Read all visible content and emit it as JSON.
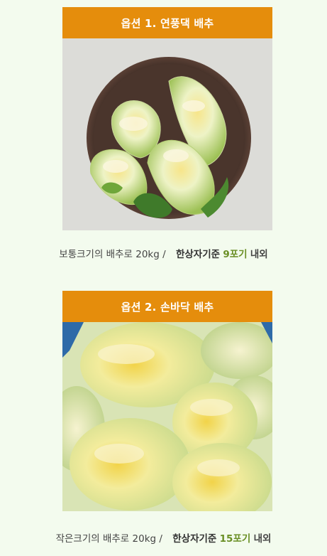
{
  "options": [
    {
      "title": "옵션 1. 연풍댁 배추",
      "image_alt": "napa-cabbage-in-bowl",
      "caption_desc": "보통크기의 배추로 20kg /",
      "caption_std": "한상자기준",
      "caption_count": "9포기",
      "caption_suffix": "내외"
    },
    {
      "title": "옵션 2. 손바닥 배추",
      "image_alt": "small-napa-cabbages-in-crate",
      "caption_desc": "작은크기의 배추로 20kg /",
      "caption_std": "한상자기준",
      "caption_count": "15포기",
      "caption_suffix": "내외"
    }
  ],
  "colors": {
    "page_bg": "#f3fbee",
    "banner": "#e58d0c",
    "highlight": "#6a8f25"
  }
}
